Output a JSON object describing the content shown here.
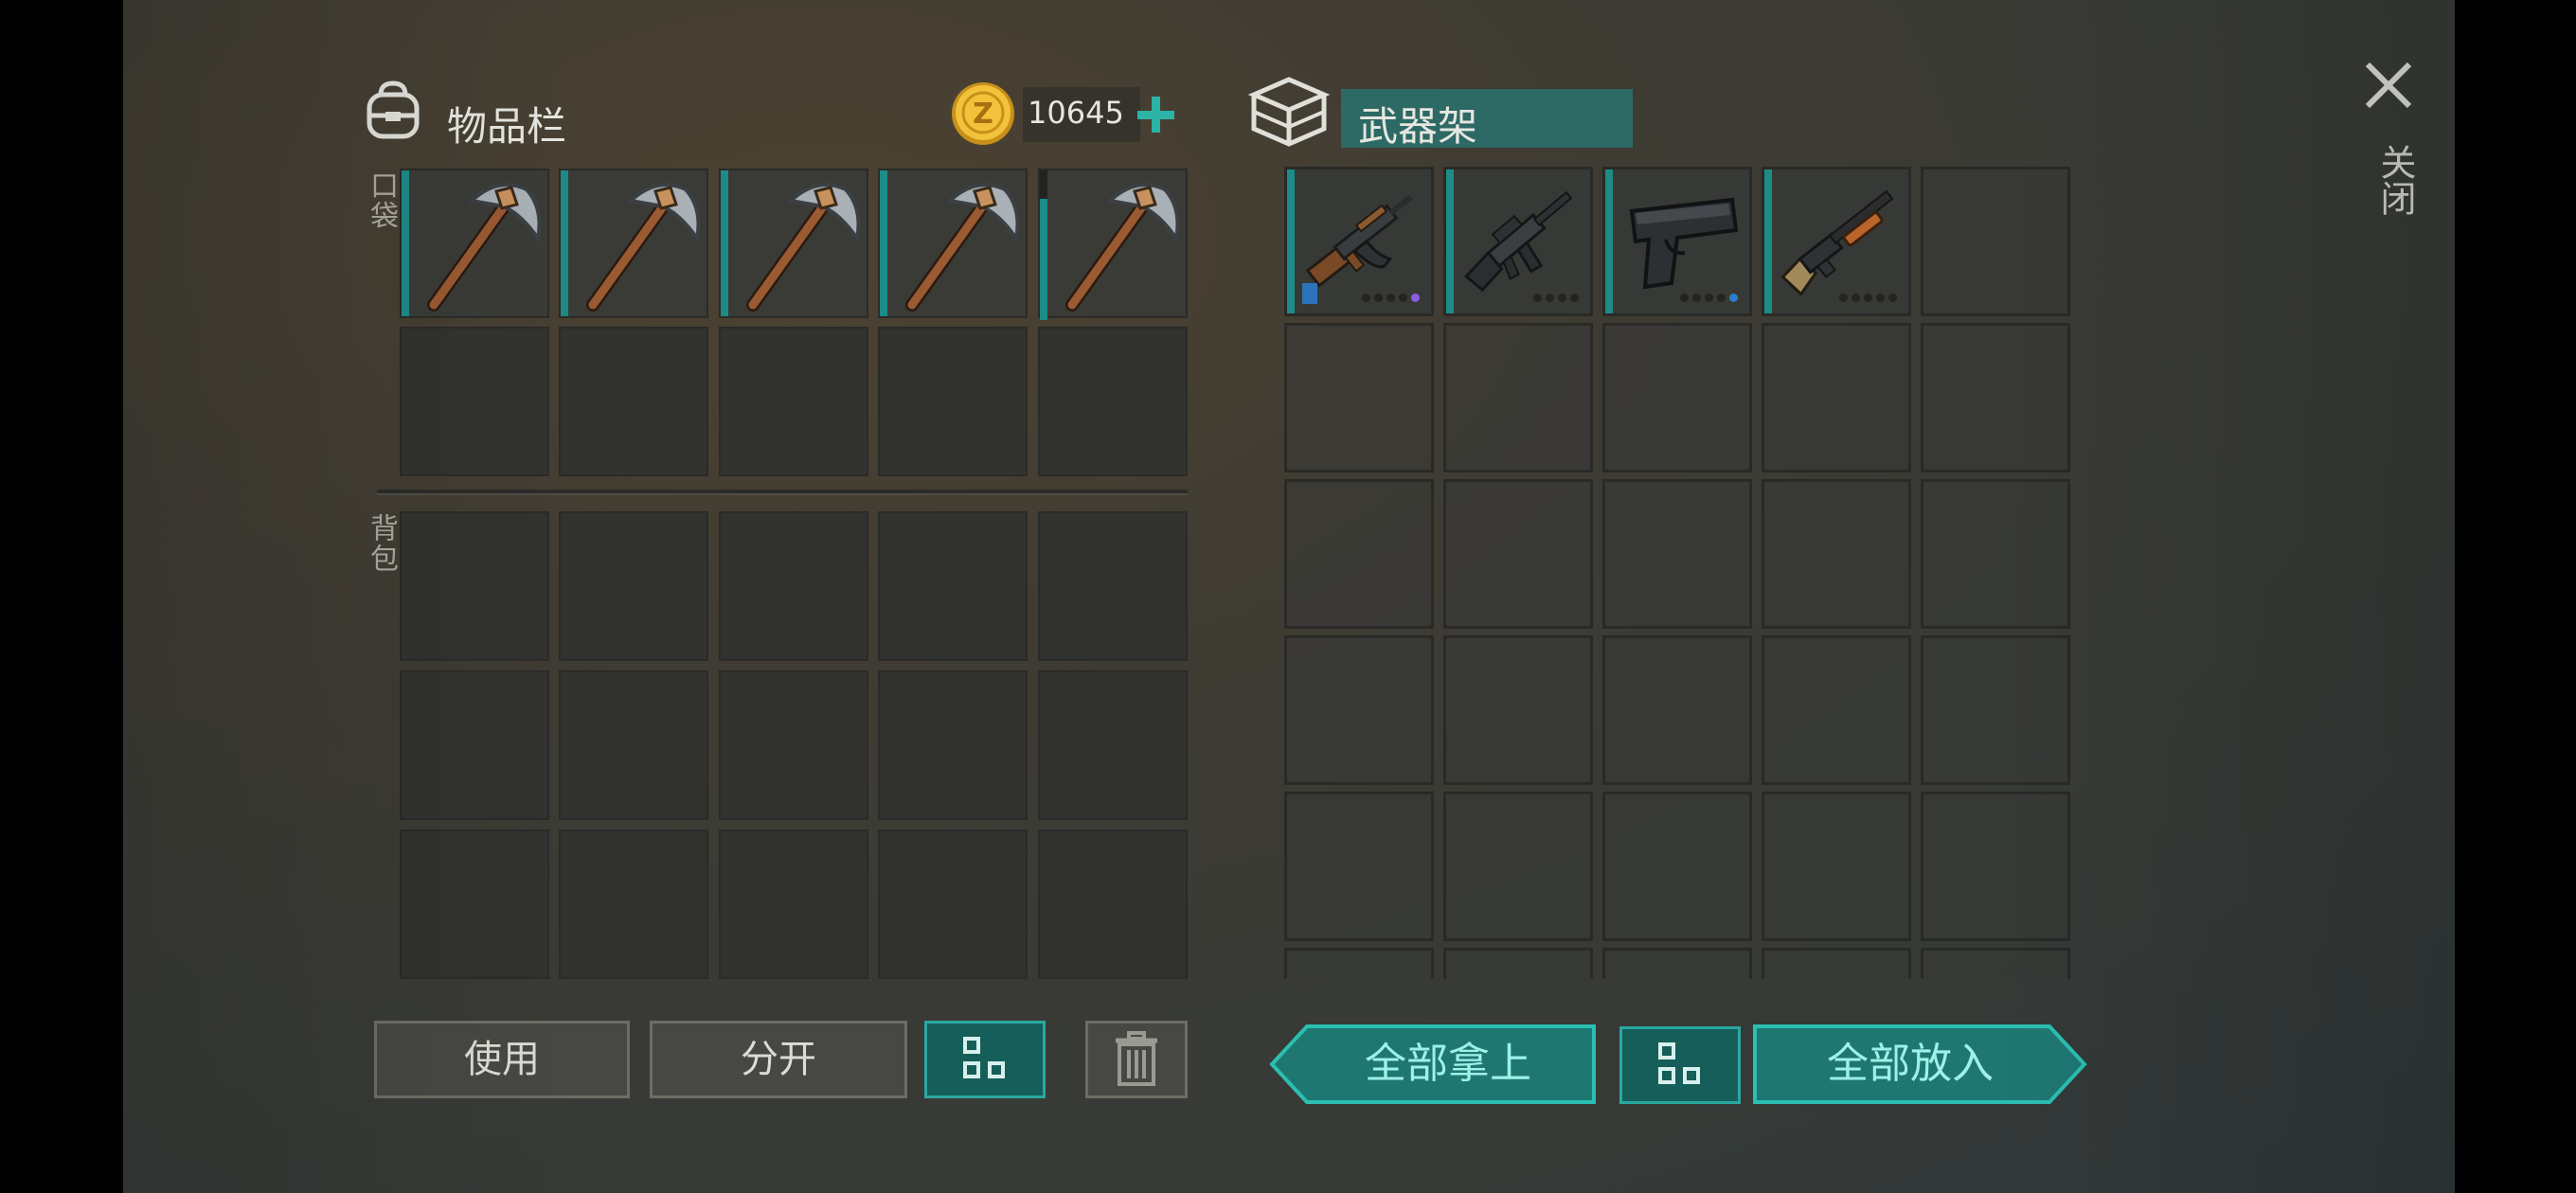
{
  "inventory": {
    "title": "物品栏",
    "pocket_label": "口袋",
    "backpack_label": "背包",
    "coins": "10645"
  },
  "rack": {
    "title": "武器架"
  },
  "close_label": "关闭",
  "buttons": {
    "use": "使用",
    "split": "分开",
    "take_all": "全部拿上",
    "put_all": "全部放入"
  },
  "icons": {
    "backpack": "backpack-icon",
    "coin": "coin-icon",
    "add": "plus-icon",
    "crate": "crate-icon",
    "close": "close-icon",
    "sort": "sort-grid-icon",
    "trash": "trash-icon",
    "pickaxe": "pickaxe-icon",
    "ak": "assault-rifle-icon",
    "m16": "m16-rifle-icon",
    "pistol": "pistol-icon",
    "shotgun": "shotgun-icon"
  },
  "colors": {
    "accent": "#1d8b86",
    "rare_dot": "#8b5fe0",
    "blue_dot": "#2a7fd1"
  }
}
